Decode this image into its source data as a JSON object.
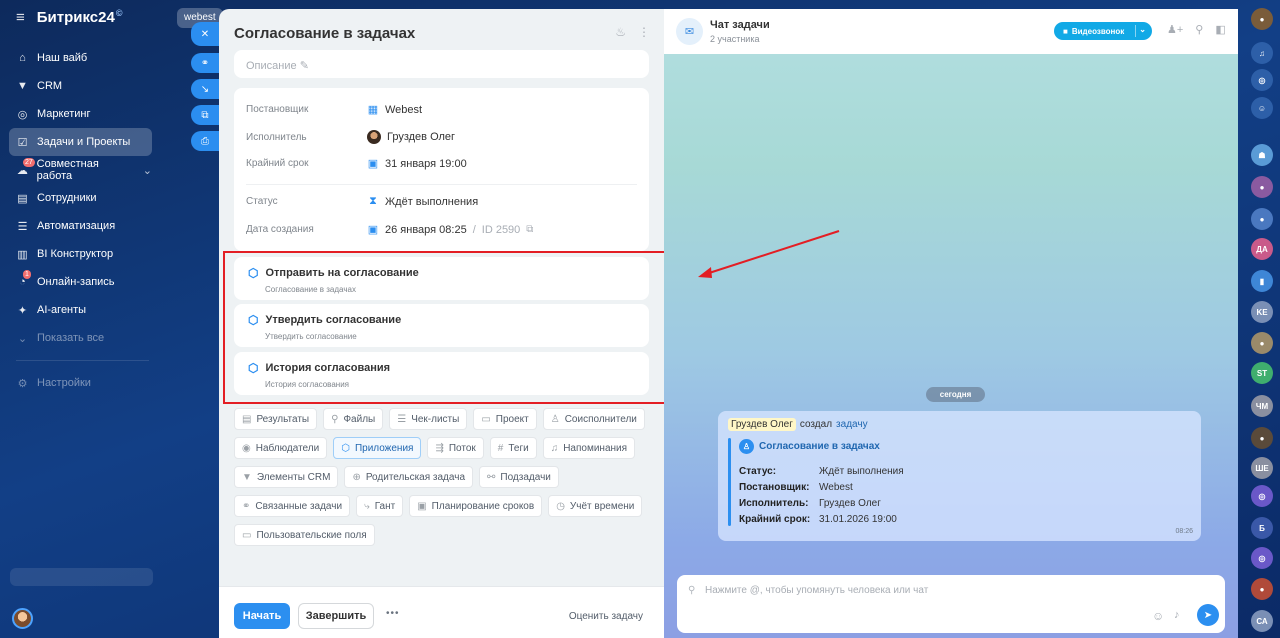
{
  "brand": {
    "name": "Битрикс24",
    "mark": "©",
    "menu_icon": "hamburger-icon"
  },
  "nav": {
    "items": [
      {
        "label": "Наш вайб",
        "icon": "home-icon"
      },
      {
        "label": "CRM",
        "icon": "crm-icon"
      },
      {
        "label": "Маркетинг",
        "icon": "marketing-icon"
      },
      {
        "label": "Задачи и Проекты",
        "icon": "tasks-icon"
      },
      {
        "label": "Совместная работа",
        "icon": "collab-icon",
        "badge": "27"
      },
      {
        "label": "Сотрудники",
        "icon": "employees-icon"
      },
      {
        "label": "Автоматизация",
        "icon": "automation-icon"
      },
      {
        "label": "BI Конструктор",
        "icon": "bi-icon"
      },
      {
        "label": "Онлайн-запись",
        "icon": "booking-icon",
        "badge": "1"
      },
      {
        "label": "AI-агенты",
        "icon": "ai-icon"
      },
      {
        "label": "Показать все",
        "icon": "chevron-down-icon"
      },
      {
        "label": "Настройки",
        "icon": "settings-icon"
      }
    ]
  },
  "bg_tab": {
    "label": "webest"
  },
  "task": {
    "title": "Согласование в задачах",
    "description_placeholder": "Описание",
    "fields": {
      "creator_label": "Постановщик",
      "creator_value": "Webest",
      "assignee_label": "Исполнитель",
      "assignee_value": "Груздев Олег",
      "deadline_label": "Крайний срок",
      "deadline_value": "31 января 19:00",
      "status_label": "Статус",
      "status_value": "Ждёт выполнения",
      "created_label": "Дата создания",
      "created_value": "26 января 08:25",
      "id_sep": "/",
      "id_value": "ID 2590"
    },
    "apps": [
      {
        "title": "Отправить на согласование",
        "subtitle": "Согласование в задачах"
      },
      {
        "title": "Утвердить согласование",
        "subtitle": "Утвердить согласование"
      },
      {
        "title": "История согласования",
        "subtitle": "История согласования"
      }
    ],
    "chips": {
      "results": "Результаты",
      "files": "Файлы",
      "checklists": "Чек-листы",
      "project": "Проект",
      "coexecutors": "Соисполнители",
      "observers": "Наблюдатели",
      "apps": "Приложения",
      "flow": "Поток",
      "tags": "Теги",
      "reminders": "Напоминания",
      "crm": "Элементы CRM",
      "parent": "Родительская задача",
      "subtasks": "Подзадачи",
      "related": "Связанные задачи",
      "gantt": "Гант",
      "planning": "Планирование сроков",
      "time": "Учёт времени",
      "custom": "Пользовательские поля"
    },
    "footer": {
      "start": "Начать",
      "finish": "Завершить",
      "more": "•••",
      "rate": "Оценить задачу"
    }
  },
  "chat": {
    "title": "Чат задачи",
    "subtitle": "2 участника",
    "video_label": "Видеозвонок",
    "date_divider": "сегодня",
    "message": {
      "author": "Груздев Олег",
      "action": "создал",
      "link": "задачу",
      "task_title": "Согласование в задачах",
      "rows": [
        {
          "k": "Статус:",
          "v": "Ждёт выполнения"
        },
        {
          "k": "Постановщик:",
          "v": "Webest"
        },
        {
          "k": "Исполнитель:",
          "v": "Груздев Олег"
        },
        {
          "k": "Крайний срок:",
          "v": "31.01.2026 19:00"
        }
      ],
      "time": "08:26"
    },
    "input_placeholder": "Нажмите @, чтобы упомянуть человека или чат"
  },
  "rightbar": {
    "items": [
      {
        "label": "",
        "color": "#7a5c3a",
        "icon": "user-avatar-icon"
      },
      {
        "label": "",
        "color": "#2d5fa8",
        "icon": "bell-icon"
      },
      {
        "label": "",
        "color": "#2d5fa8",
        "icon": "copilot-icon"
      },
      {
        "label": "",
        "color": "#2d5fa8",
        "icon": "chat-icon"
      },
      {
        "label": "",
        "color": "#5a9bd6",
        "icon": "group-chat-icon"
      },
      {
        "label": "",
        "color": "#8a5aa0",
        "icon": "avatar-icon"
      },
      {
        "label": "",
        "color": "#4a78c0",
        "icon": "avatar-icon"
      },
      {
        "label": "ДА",
        "color": "#c95a8a",
        "icon": ""
      },
      {
        "label": "",
        "color": "#3e86d6",
        "icon": "bookmark-icon"
      },
      {
        "label": "KE",
        "color": "#7a8fb5",
        "icon": ""
      },
      {
        "label": "",
        "color": "#9a8a6a",
        "icon": "avatar-icon"
      },
      {
        "label": "ST",
        "color": "#3fae6e",
        "icon": ""
      },
      {
        "label": "ЧМ",
        "color": "#8a8fa0",
        "icon": ""
      },
      {
        "label": "",
        "color": "#5a4a3a",
        "icon": "avatar-icon"
      },
      {
        "label": "ШЕ",
        "color": "#8a8fa0",
        "icon": ""
      },
      {
        "label": "",
        "color": "#6a58c8",
        "icon": "copilot-icon"
      },
      {
        "label": "Б",
        "color": "#3a58a8",
        "icon": ""
      },
      {
        "label": "",
        "color": "#6a58c8",
        "icon": "copilot-icon"
      },
      {
        "label": "",
        "color": "#b04a3a",
        "icon": "avatar-icon"
      },
      {
        "label": "СА",
        "color": "#7a8fb5",
        "icon": ""
      }
    ]
  }
}
